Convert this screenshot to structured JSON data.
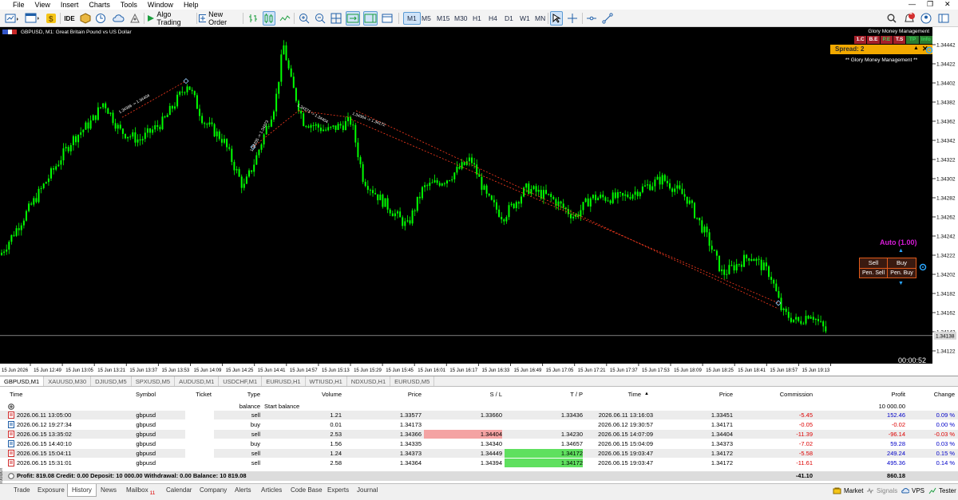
{
  "menu": [
    "File",
    "View",
    "Insert",
    "Charts",
    "Tools",
    "Window",
    "Help"
  ],
  "toolbar": {
    "ide": "IDE",
    "algo_trading": "Algo Trading",
    "new_order": "New Order",
    "timeframes": [
      "M1",
      "M5",
      "M15",
      "M30",
      "H1",
      "H4",
      "D1",
      "W1",
      "MN"
    ],
    "active_timeframe": "M1",
    "notification_count": "1"
  },
  "chart": {
    "symbol_title": "GBPUSD, M1:  Great Britain Pound vs US Dollar",
    "countdown": "00:00:52",
    "price_labels": [
      "1.34442",
      "1.34422",
      "1.34402",
      "1.34382",
      "1.34362",
      "1.34342",
      "1.34322",
      "1.34302",
      "1.34282",
      "1.34262",
      "1.34242",
      "1.34222",
      "1.34202",
      "1.34182",
      "1.34162",
      "1.34142",
      "1.34122"
    ],
    "current_price": "1.34138",
    "time_labels": [
      "15 Jun 2026",
      "15 Jun 12:49",
      "15 Jun 13:05",
      "15 Jun 13:21",
      "15 Jun 13:37",
      "15 Jun 13:53",
      "15 Jun 14:09",
      "15 Jun 14:25",
      "15 Jun 14:41",
      "15 Jun 14:57",
      "15 Jun 15:13",
      "15 Jun 15:29",
      "15 Jun 15:45",
      "15 Jun 16:01",
      "15 Jun 16:17",
      "15 Jun 16:33",
      "15 Jun 16:49",
      "15 Jun 17:05",
      "15 Jun 17:21",
      "15 Jun 17:37",
      "15 Jun 17:53",
      "15 Jun 18:09",
      "15 Jun 18:25",
      "15 Jun 18:41",
      "15 Jun 18:57",
      "15 Jun 19:13"
    ],
    "trade_labels": [
      "1.34366 -> 1.34404",
      "1.34335 -> 1.34373",
      "1.34373 -> 1.34404",
      "1.34364 -> 1.34172"
    ],
    "bg": "#000000",
    "candle": "#00ff00"
  },
  "gmm": {
    "title": "Glory Money Management",
    "buttons": [
      "1.C",
      "B.E",
      "P.E",
      "T.S",
      "TP",
      "Info"
    ],
    "spread": "Spread: 2",
    "subtitle": "** Glory Money Management **",
    "auto": "Auto (1.00)",
    "sell": "Sell",
    "buy": "Buy",
    "pen_sell": "Pen. Sell",
    "pen_buy": "Pen. Buy"
  },
  "symbol_tabs": [
    "GBPUSD,M1",
    "XAUUSD,M30",
    "DJIUSD,M5",
    "SPXUSD,M5",
    "AUDUSD,M1",
    "USDCHF,M1",
    "EURUSD,H1",
    "WTIUSD,H1",
    "NDXUSD,H1",
    "EURUSD,M5"
  ],
  "history": {
    "headers": [
      "Time",
      "Symbol",
      "Ticket",
      "Type",
      "Volume",
      "Price",
      "S / L",
      "T / P",
      "Time",
      "Price",
      "Commission",
      "Profit",
      "Change"
    ],
    "balance_row": {
      "type": "balance",
      "desc": "Start balance",
      "profit": "10 000.00"
    },
    "rows": [
      {
        "time": "2026.06.11 13:05:00",
        "symbol": "gbpusd",
        "type": "sell",
        "volume": "1.21",
        "price": "1.33577",
        "sl": "1.33660",
        "tp": "1.33436",
        "time2": "2026.06.11 13:16:03",
        "price2": "1.33451",
        "commission": "-5.45",
        "profit": "152.46",
        "change": "0.09 %"
      },
      {
        "time": "2026.06.12 19:27:34",
        "symbol": "gbpusd",
        "type": "buy",
        "volume": "0.01",
        "price": "1.34173",
        "sl": "",
        "tp": "",
        "time2": "2026.06.12 19:30:57",
        "price2": "1.34171",
        "commission": "-0.05",
        "profit": "-0.02",
        "change": "0.00 %"
      },
      {
        "time": "2026.06.15 13:35:02",
        "symbol": "gbpusd",
        "type": "sell",
        "volume": "2.53",
        "price": "1.34366",
        "sl": "1.34404",
        "tp": "1.34230",
        "time2": "2026.06.15 14:07:09",
        "price2": "1.34404",
        "commission": "-11.39",
        "profit": "-96.14",
        "change": "-0.03 %"
      },
      {
        "time": "2026.06.15 14:40:10",
        "symbol": "gbpusd",
        "type": "buy",
        "volume": "1.56",
        "price": "1.34335",
        "sl": "1.34340",
        "tp": "1.34657",
        "time2": "2026.06.15 15:04:09",
        "price2": "1.34373",
        "commission": "-7.02",
        "profit": "59.28",
        "change": "0.03 %"
      },
      {
        "time": "2026.06.15 15:04:11",
        "symbol": "gbpusd",
        "type": "sell",
        "volume": "1.24",
        "price": "1.34373",
        "sl": "1.34449",
        "tp": "1.34172",
        "time2": "2026.06.15 19:03:47",
        "price2": "1.34172",
        "commission": "-5.58",
        "profit": "249.24",
        "change": "0.15 %"
      },
      {
        "time": "2026.06.15 15:31:01",
        "symbol": "gbpusd",
        "type": "sell",
        "volume": "2.58",
        "price": "1.34364",
        "sl": "1.34394",
        "tp": "1.34172",
        "time2": "2026.06.15 19:03:47",
        "price2": "1.34172",
        "commission": "-11.61",
        "profit": "495.36",
        "change": "0.14 %"
      }
    ],
    "summary": "Profit: 819.08  Credit: 0.00  Deposit: 10 000.00  Withdrawal: 0.00  Balance: 10 819.08",
    "total_commission": "-41.10",
    "total_profit": "860.18"
  },
  "tabs": [
    "Trade",
    "Exposure",
    "History",
    "News",
    "Mailbox",
    "Calendar",
    "Company",
    "Alerts",
    "Articles",
    "Code Base",
    "Experts",
    "Journal"
  ],
  "mailbox_count": "11",
  "toolbox_label": "Toolbox",
  "status": {
    "market": "Market",
    "signals": "Signals",
    "vps": "VPS",
    "tester": "Tester"
  }
}
